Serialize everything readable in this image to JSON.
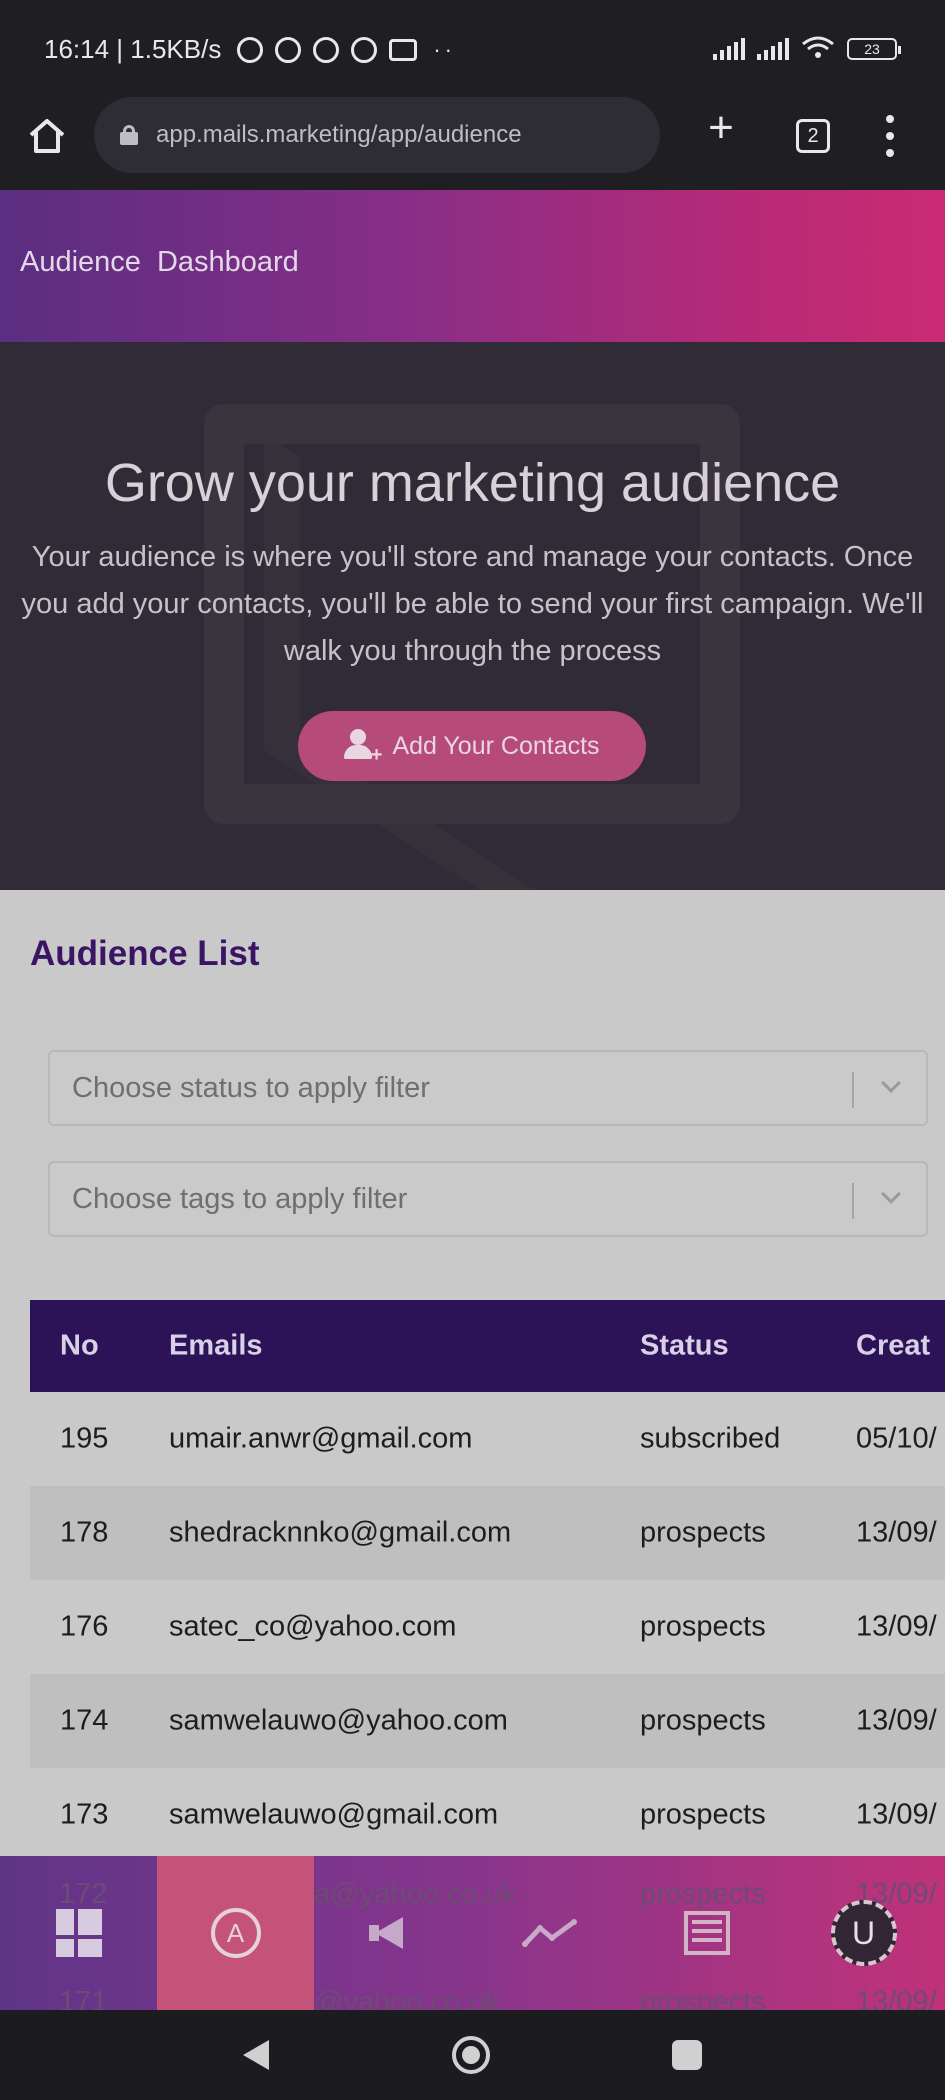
{
  "status_bar": {
    "time_speed": "16:14 | 1.5KB/s",
    "battery": "23",
    "icons": [
      "mute-bell-icon",
      "alarm-icon",
      "whatsapp-icon",
      "alarm-clock-icon",
      "gmail-icon"
    ]
  },
  "browser": {
    "url": "app.mails.marketing/app/audience",
    "tab_count": "2"
  },
  "header": {
    "breadcrumb": [
      "Audience",
      "Dashboard"
    ]
  },
  "hero": {
    "title": "Grow your marketing audience",
    "text": "Your audience is where you'll store and manage your contacts. Once you add your contacts, you'll be able to send your first campaign. We'll walk you through the process",
    "cta_label": "Add Your Contacts"
  },
  "audience": {
    "title": "Audience List",
    "status_filter_placeholder": "Choose status to apply filter",
    "tags_filter_placeholder": "Choose tags to apply filter",
    "columns": [
      "No",
      "Emails",
      "Status",
      "Creat"
    ],
    "rows": [
      {
        "no": "195",
        "email": "umair.anwr@gmail.com",
        "status": "subscribed",
        "created": "05/10/"
      },
      {
        "no": "178",
        "email": "shedracknnko@gmail.com",
        "status": "prospects",
        "created": "13/09/"
      },
      {
        "no": "176",
        "email": "satec_co@yahoo.com",
        "status": "prospects",
        "created": "13/09/"
      },
      {
        "no": "174",
        "email": "samwelauwo@yahoo.com",
        "status": "prospects",
        "created": "13/09/"
      },
      {
        "no": "173",
        "email": "samwelauwo@gmail.com",
        "status": "prospects",
        "created": "13/09/"
      }
    ],
    "peek_rows": [
      {
        "no": "172",
        "email": "a@yahoo.co.uk",
        "status": "prospects",
        "created": "13/09/"
      },
      {
        "no": "171",
        "email": "@yahoo.co.uk",
        "status": "prospects",
        "created": "13/09/"
      }
    ]
  },
  "bottom_nav": {
    "user_initial": "U"
  },
  "colors": {
    "header_gradient_start": "#5a2e82",
    "header_gradient_end": "#c92b73",
    "table_header": "#2c1256",
    "accent_title": "#3b1466",
    "cta": "#b54a7b"
  }
}
